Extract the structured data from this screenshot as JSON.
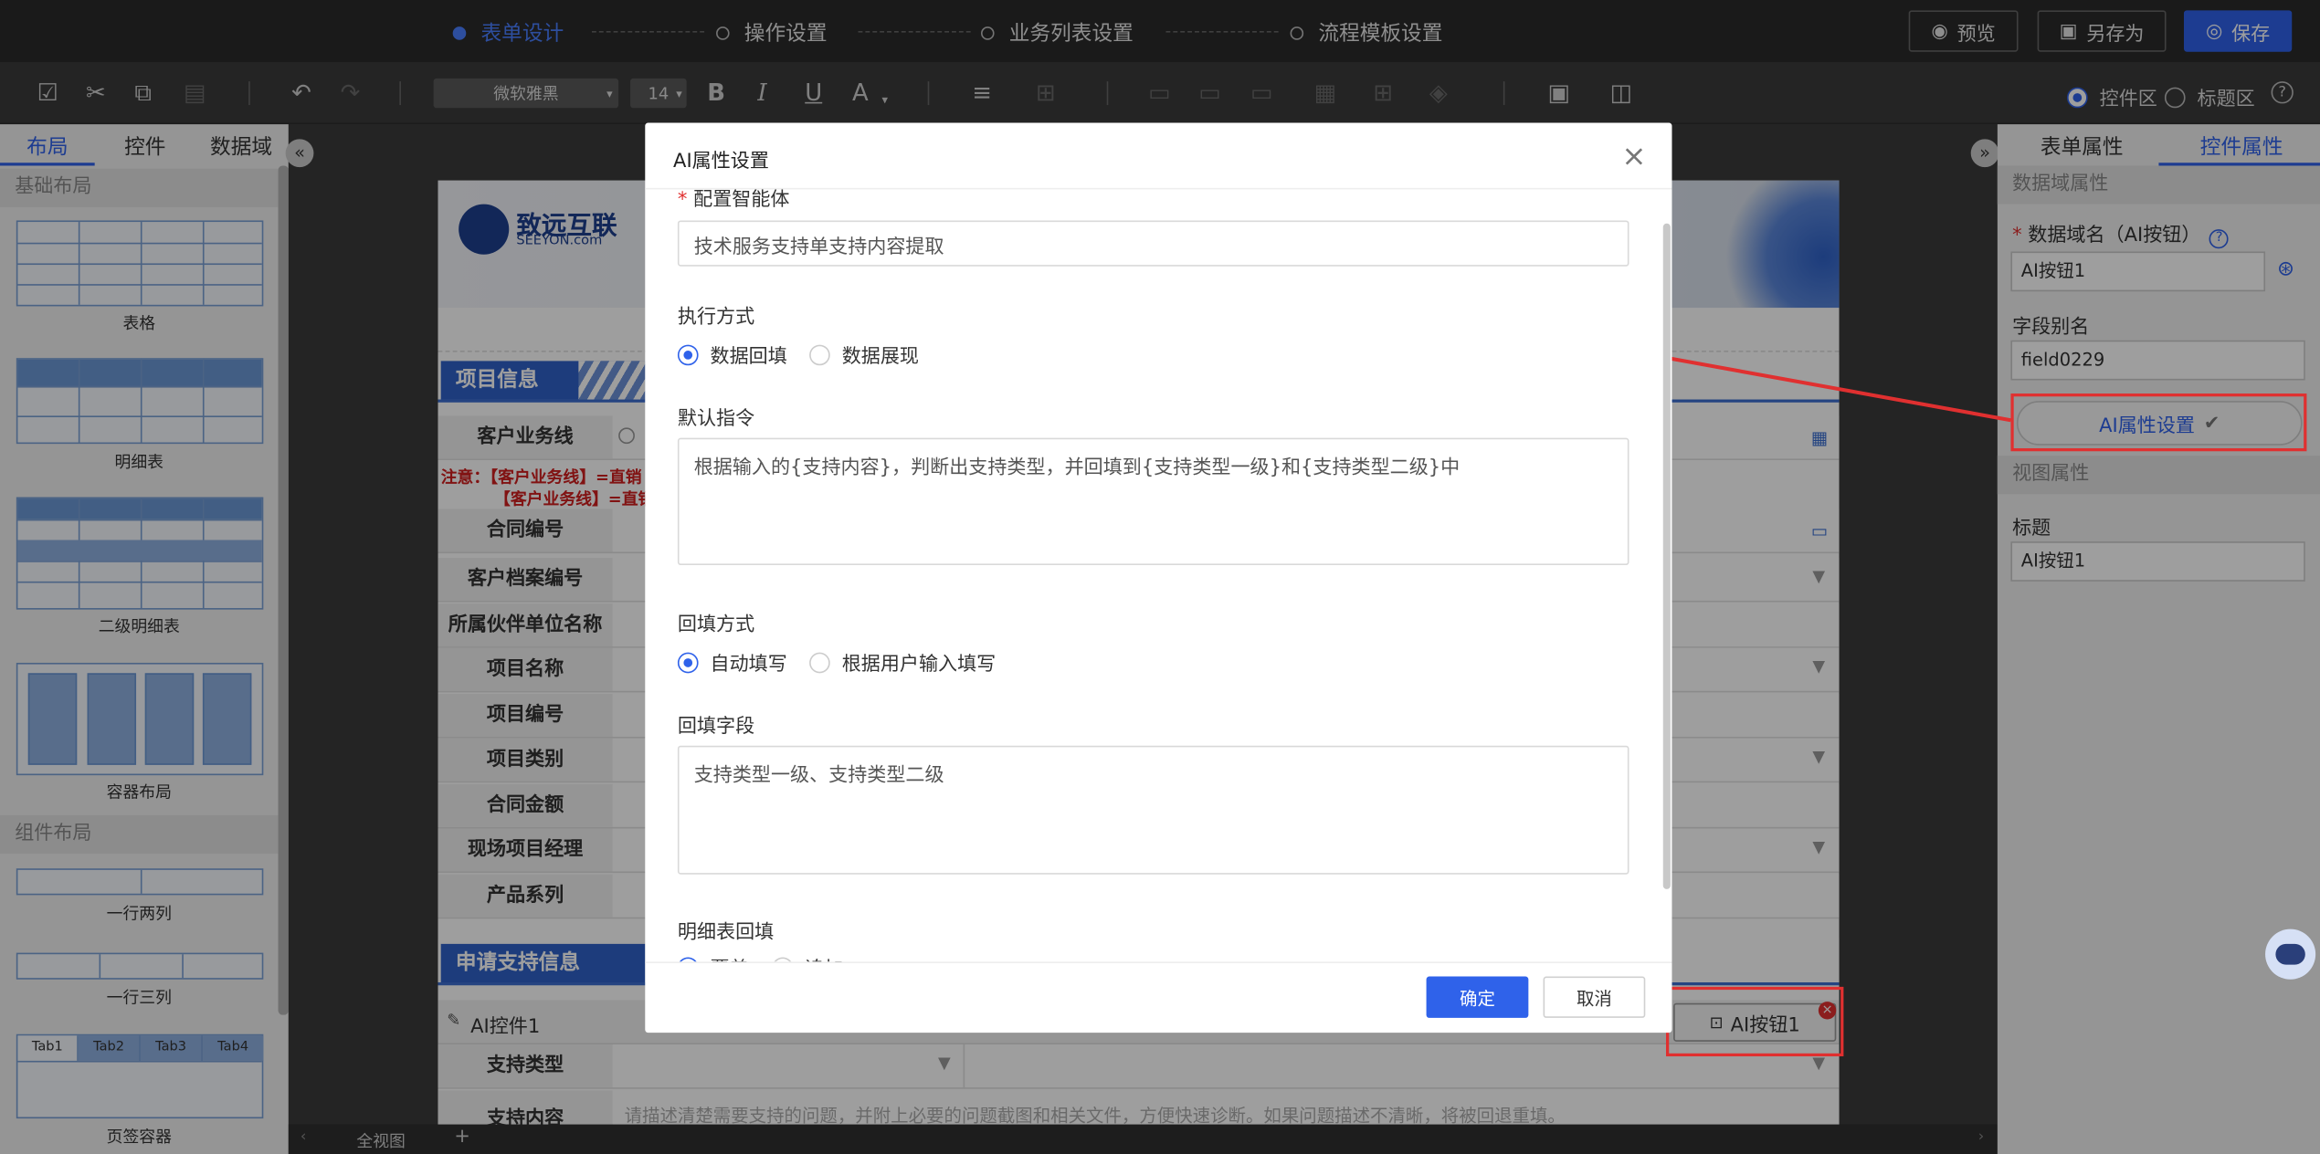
{
  "steps": [
    {
      "label": "表单设计",
      "active": true
    },
    {
      "label": "操作设置",
      "active": false
    },
    {
      "label": "业务列表设置",
      "active": false
    },
    {
      "label": "流程模板设置",
      "active": false
    }
  ],
  "top_buttons": {
    "preview": "预览",
    "save_as": "另存为",
    "save": "保存"
  },
  "toolbar": {
    "font_family": "微软雅黑",
    "font_size": "14",
    "bold": "B",
    "italic": "I",
    "underline": "U",
    "font_color": "A"
  },
  "left_panel": {
    "tabs": [
      "布局",
      "控件",
      "数据域"
    ],
    "section_basic": "基础布局",
    "items_basic": [
      "表格",
      "明细表",
      "二级明细表",
      "容器布局"
    ],
    "section_component": "组件布局",
    "items_component": [
      "一行两列",
      "一行三列",
      "页签容器"
    ],
    "tab_container_tabs": [
      "Tab1",
      "Tab2",
      "Tab3",
      "Tab4"
    ]
  },
  "canvas": {
    "logo_cn": "致远互联",
    "logo_en": "SEEYON.com",
    "section1": "项目信息",
    "rows": [
      "客户业务线",
      "合同编号",
      "客户档案编号",
      "所属伙伴单位名称",
      "项目名称",
      "项目编号",
      "项目类别",
      "合同金额",
      "现场项目经理",
      "产品系列"
    ],
    "notice1": "注意：【客户业务线】=直销",
    "notice2": "【客户业务线】=直销",
    "section2": "申请支持信息",
    "ai_control_label": "AI控件1",
    "ai_button_label": "AI按钮1",
    "row_support_type": "支持类型",
    "row_support_content": "支持内容",
    "support_placeholder": "请描述清楚需要支持的问题，并附上必要的问题截图和相关文件，方便快速诊断。如果问题描述不清晰，将被回退重填。",
    "bottom_tab": "全视图",
    "bottom_add": "+"
  },
  "right_panel": {
    "tabs": [
      "表单属性",
      "控件属性"
    ],
    "view_toggle": [
      "控件区",
      "标题区"
    ],
    "help": "?",
    "section_data": "数据域属性",
    "field_name_label": "数据域名（AI按钮）",
    "field_name_value": "AI按钮1",
    "alias_label": "字段别名",
    "alias_value": "field0229",
    "ai_settings_button": "AI属性设置",
    "section_view": "视图属性",
    "title_label": "标题",
    "title_value": "AI按钮1"
  },
  "modal": {
    "title": "AI属性设置",
    "agent_label": "配置智能体",
    "agent_value": "技术服务支持单支持内容提取",
    "exec_label": "执行方式",
    "exec_options": [
      "数据回填",
      "数据展现"
    ],
    "exec_selected": 0,
    "prompt_label": "默认指令",
    "prompt_value": "根据输入的{支持内容}，判断出支持类型，并回填到{支持类型一级}和{支持类型二级}中",
    "fill_label": "回填方式",
    "fill_options": [
      "自动填写",
      "根据用户输入填写"
    ],
    "fill_selected": 0,
    "fill_field_label": "回填字段",
    "fill_field_value": "支持类型一级、支持类型二级",
    "detail_label": "明细表回填",
    "detail_options": [
      "覆盖",
      "追加"
    ],
    "ok": "确定",
    "cancel": "取消"
  },
  "colors": {
    "accent": "#2f62ea",
    "highlight": "#e03030",
    "topbar": "#2a2a2a"
  }
}
